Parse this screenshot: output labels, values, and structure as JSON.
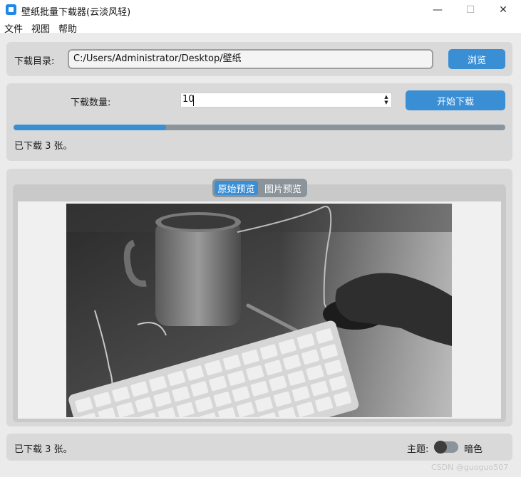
{
  "window": {
    "title": "壁纸批量下载器(云淡风轻)",
    "minimize": "—",
    "maximize": "☐",
    "close": "✕"
  },
  "menu": [
    "文件",
    "视图",
    "帮助"
  ],
  "dir": {
    "label": "下载目录:",
    "path": "C:/Users/Administrator/Desktop/壁纸",
    "browse": "浏览"
  },
  "download": {
    "label": "下载数量:",
    "count": "10",
    "start": "开始下载",
    "progress": 0.31,
    "status": "已下载 3 张。"
  },
  "preview": {
    "tabs": [
      "原始预览",
      "图片预览"
    ],
    "active": 0
  },
  "footer": {
    "status": "已下载 3 张。",
    "theme_label": "主题:",
    "theme_value": "暗色"
  },
  "watermark": "CSDN @guoguo507",
  "colors": {
    "accent": "#3a8ed4",
    "track": "#8b949a",
    "frame": "#d9d9d9"
  }
}
